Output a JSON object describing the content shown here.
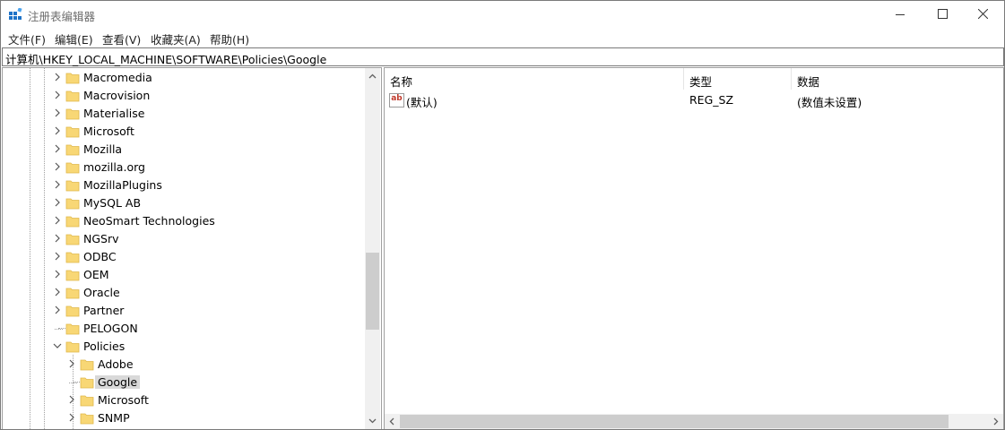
{
  "window": {
    "title": "注册表编辑器"
  },
  "menu": [
    "文件(F)",
    "编辑(E)",
    "查看(V)",
    "收藏夹(A)",
    "帮助(H)"
  ],
  "address": {
    "path": "计算机\\HKEY_LOCAL_MACHINE\\SOFTWARE\\Policies\\Google"
  },
  "tree": {
    "items": [
      {
        "label": "Macromedia",
        "expander": "collapsed"
      },
      {
        "label": "Macrovision",
        "expander": "collapsed"
      },
      {
        "label": "Materialise",
        "expander": "collapsed"
      },
      {
        "label": "Microsoft",
        "expander": "collapsed"
      },
      {
        "label": "Mozilla",
        "expander": "collapsed"
      },
      {
        "label": "mozilla.org",
        "expander": "collapsed"
      },
      {
        "label": "MozillaPlugins",
        "expander": "collapsed"
      },
      {
        "label": "MySQL AB",
        "expander": "collapsed"
      },
      {
        "label": "NeoSmart Technologies",
        "expander": "collapsed"
      },
      {
        "label": "NGSrv",
        "expander": "collapsed"
      },
      {
        "label": "ODBC",
        "expander": "collapsed"
      },
      {
        "label": "OEM",
        "expander": "collapsed"
      },
      {
        "label": "Oracle",
        "expander": "collapsed"
      },
      {
        "label": "Partner",
        "expander": "collapsed"
      },
      {
        "label": "PELOGON",
        "expander": "none"
      },
      {
        "label": "Policies",
        "expander": "expanded"
      },
      {
        "label": "Adobe",
        "expander": "collapsed"
      },
      {
        "label": "Google",
        "expander": "none",
        "selected": true
      },
      {
        "label": "Microsoft",
        "expander": "collapsed"
      },
      {
        "label": "SNMP",
        "expander": "collapsed"
      }
    ]
  },
  "values": {
    "columns": [
      "名称",
      "类型",
      "数据"
    ],
    "rows": [
      {
        "name": "(默认)",
        "type": "REG_SZ",
        "data": "(数值未设置)",
        "icon": "string-value-icon"
      }
    ]
  },
  "colors": {
    "folder": "#f8d775",
    "folder_edge": "#e0b84a",
    "selection": "#d9d9d9",
    "scroll_thumb": "#cdcdcd"
  }
}
